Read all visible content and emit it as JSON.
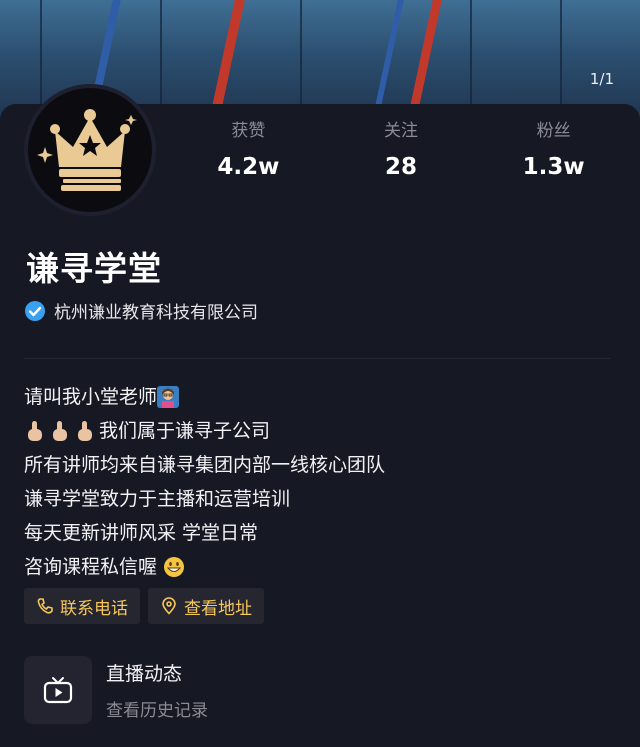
{
  "header": {
    "page_indicator": "1/1"
  },
  "profile": {
    "name": "谦寻学堂",
    "verification": "杭州谦业教育科技有限公司"
  },
  "stats": [
    {
      "label": "获赞",
      "value": "4.2w"
    },
    {
      "label": "关注",
      "value": "28"
    },
    {
      "label": "粉丝",
      "value": "1.3w"
    }
  ],
  "bio": [
    {
      "text": "请叫我小堂老师",
      "emoji": "teacher-emoji"
    },
    {
      "text": "我们属于谦寻子公司",
      "emoji": "pointing-up-emoji"
    },
    {
      "text": "所有讲师均来自谦寻集团内部一线核心团队"
    },
    {
      "text": "谦寻学堂致力于主播和运营培训"
    },
    {
      "text": "每天更新讲师风采 学堂日常"
    },
    {
      "text": "咨询课程私信喔",
      "emoji": "grinning-emoji"
    }
  ],
  "buttons": {
    "contact": "联系电话",
    "address": "查看地址"
  },
  "live": {
    "title": "直播动态",
    "subtitle": "查看历史记录"
  },
  "colors": {
    "background": "#161823",
    "accent_gold": "#f7c75a",
    "verified_blue": "#3aa0f0",
    "muted_text": "#8a8b94"
  }
}
